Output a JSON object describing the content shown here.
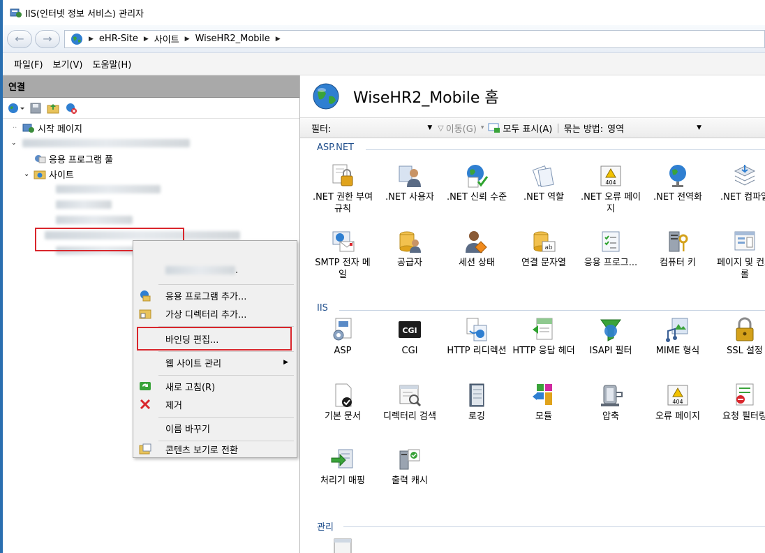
{
  "window": {
    "title": "IIS(인터넷 정보 서비스) 관리자"
  },
  "address": {
    "back": "←",
    "forward": "→",
    "crumbs": [
      "eHR-Site",
      "사이트",
      "WiseHR2_Mobile"
    ]
  },
  "menu": [
    "파일(F)",
    "보기(V)",
    "도움말(H)"
  ],
  "connections": {
    "header": "연결",
    "tree": {
      "start_page": "시작 페이지",
      "app_pools": "응용 프로그램 풀",
      "sites": "사이트"
    }
  },
  "context_menu": {
    "blurred_item": ".",
    "items": [
      {
        "label": "응용 프로그램 추가...",
        "icon": "add-app-icon"
      },
      {
        "label": "가상 디렉터리 추가...",
        "icon": "add-vdir-icon"
      },
      {
        "label": "바인딩 편집...",
        "icon": ""
      },
      {
        "label": "웹 사이트 관리",
        "icon": ""
      },
      {
        "label": "새로 고침(R)",
        "icon": "refresh-icon"
      },
      {
        "label": "제거",
        "icon": "remove-icon"
      },
      {
        "label": "이름 바꾸기",
        "icon": ""
      },
      {
        "label": "콘텐츠 보기로 전환",
        "icon": "content-view-icon"
      }
    ]
  },
  "home": {
    "title": "WiseHR2_Mobile 홈",
    "filter_label": "필터:",
    "go_label": "이동(G)",
    "show_all_label": "모두 표시(A)",
    "group_by_label": "묶는 방법:",
    "group_by_value": "영역"
  },
  "groups": {
    "aspnet": "ASP.NET",
    "iis": "IIS",
    "management": "관리"
  },
  "features_aspnet_row1": [
    ".NET 권한 부여 규칙",
    ".NET 사용자",
    ".NET 신뢰 수준",
    ".NET 역할",
    ".NET 오류 페이지",
    ".NET 전역화",
    ".NET 컴파일"
  ],
  "features_aspnet_row2": [
    "SMTP 전자 메일",
    "공급자",
    "세션 상태",
    "연결 문자열",
    "응용 프로그...",
    "컴퓨터 키",
    "페이지 및 컨트롤"
  ],
  "features_iis_row1": [
    "ASP",
    "CGI",
    "HTTP 리디렉션",
    "HTTP 응답 헤더",
    "ISAPI 필터",
    "MIME 형식",
    "SSL 설정"
  ],
  "features_iis_row2": [
    "기본 문서",
    "디렉터리 검색",
    "로깅",
    "모듈",
    "압축",
    "오류 페이지",
    "요청 필터링"
  ],
  "features_iis_row3": [
    "처리기 매핑",
    "출력 캐시"
  ],
  "icon_text": {
    "cgi": "CGI",
    "e404": "404"
  },
  "colors": {
    "accent": "#1f4e8c",
    "highlight_red": "#d9262c",
    "panel_header": "#a9a9a9"
  }
}
